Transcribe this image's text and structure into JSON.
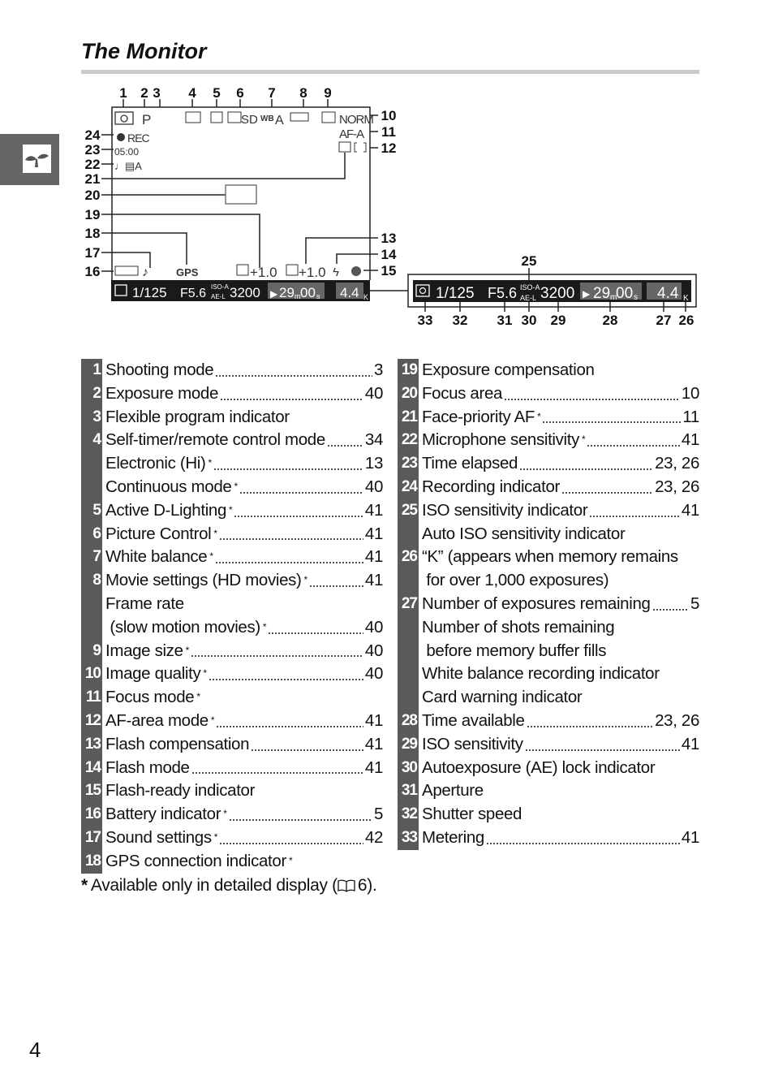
{
  "section_title": "The Monitor",
  "page_number": "4",
  "side_tab_icon": "seedling-icon",
  "diagram": {
    "callouts": [
      "1",
      "2",
      "3",
      "4",
      "5",
      "6",
      "7",
      "8",
      "9",
      "10",
      "11",
      "12",
      "13",
      "14",
      "15",
      "16",
      "17",
      "18",
      "19",
      "20",
      "21",
      "22",
      "23",
      "24",
      "25",
      "26",
      "27",
      "28",
      "29",
      "30",
      "31",
      "32",
      "33"
    ],
    "screen": {
      "rec": "REC",
      "time_elapsed": "05:00",
      "norm": "NORM",
      "focus_mode": "AF-A",
      "sd": "SD",
      "wb": "A",
      "gps": "GPS",
      "exp_comp": "+1.0",
      "flash_comp": "+1.0"
    },
    "bar": {
      "shutter": "1/125",
      "aperture": "F5.6",
      "iso_a": "ISO-A",
      "ae_l": "AE-L",
      "iso": "3200",
      "time_min": "29",
      "m": "m",
      "time_sec": "00",
      "s": "s",
      "exposures": "4.4",
      "k": "K"
    }
  },
  "left_items": [
    {
      "num": "1",
      "lines": [
        {
          "text": "Shooting mode",
          "page": "3"
        }
      ]
    },
    {
      "num": "2",
      "lines": [
        {
          "text": "Exposure mode",
          "page": "40"
        }
      ]
    },
    {
      "num": "3",
      "lines": [
        {
          "text": "Flexible program indicator"
        }
      ]
    },
    {
      "num": "4",
      "lines": [
        {
          "text": "Self-timer/remote control mode",
          "page": "34"
        },
        {
          "text": "Electronic (Hi)",
          "star": "*",
          "page": "13"
        },
        {
          "text": "Continuous mode",
          "star": "*",
          "page": "40"
        }
      ]
    },
    {
      "num": "5",
      "lines": [
        {
          "text": "Active D-Lighting",
          "star": "*",
          "page": "41"
        }
      ]
    },
    {
      "num": "6",
      "lines": [
        {
          "text": "Picture Control",
          "star": "*",
          "page": "41"
        }
      ]
    },
    {
      "num": "7",
      "lines": [
        {
          "text": "White balance",
          "star": "*",
          "page": "41"
        }
      ]
    },
    {
      "num": "8",
      "lines": [
        {
          "text": "Movie settings (HD movies)",
          "star": "*",
          "page": "41"
        },
        {
          "text": "Frame rate"
        },
        {
          "text": " (slow motion movies)",
          "star": "*",
          "page": "40"
        }
      ]
    },
    {
      "num": "9",
      "lines": [
        {
          "text": "Image size",
          "star": "*",
          "page": "40"
        }
      ]
    },
    {
      "num": "10",
      "lines": [
        {
          "text": "Image quality",
          "star": "*",
          "page": "40"
        }
      ]
    },
    {
      "num": "11",
      "lines": [
        {
          "text": "Focus mode",
          "star": "*"
        }
      ]
    },
    {
      "num": "12",
      "lines": [
        {
          "text": "AF-area mode",
          "star": "*",
          "page": "41"
        }
      ]
    },
    {
      "num": "13",
      "lines": [
        {
          "text": "Flash compensation",
          "page": "41"
        }
      ]
    },
    {
      "num": "14",
      "lines": [
        {
          "text": "Flash mode",
          "page": "41"
        }
      ]
    },
    {
      "num": "15",
      "lines": [
        {
          "text": "Flash-ready indicator"
        }
      ]
    },
    {
      "num": "16",
      "lines": [
        {
          "text": "Battery indicator",
          "star": "*",
          "page": "5"
        }
      ]
    },
    {
      "num": "17",
      "lines": [
        {
          "text": "Sound settings",
          "star": "*",
          "page": "42"
        }
      ]
    },
    {
      "num": "18",
      "lines": [
        {
          "text": "GPS connection indicator",
          "star": "*"
        }
      ]
    }
  ],
  "right_items": [
    {
      "num": "19",
      "lines": [
        {
          "text": "Exposure compensation"
        }
      ]
    },
    {
      "num": "20",
      "lines": [
        {
          "text": "Focus area",
          "page": "10"
        }
      ]
    },
    {
      "num": "21",
      "lines": [
        {
          "text": "Face-priority AF",
          "star": "*",
          "page": "11"
        }
      ]
    },
    {
      "num": "22",
      "lines": [
        {
          "text": "Microphone sensitivity",
          "star": "*",
          "page": "41"
        }
      ]
    },
    {
      "num": "23",
      "lines": [
        {
          "text": "Time elapsed",
          "page": "23, 26"
        }
      ]
    },
    {
      "num": "24",
      "lines": [
        {
          "text": "Recording indicator",
          "page": "23, 26"
        }
      ]
    },
    {
      "num": "25",
      "lines": [
        {
          "text": "ISO sensitivity indicator",
          "page": "41"
        },
        {
          "text": "Auto ISO sensitivity indicator"
        }
      ]
    },
    {
      "num": "26",
      "lines": [
        {
          "text": "“K” (appears when memory remains"
        },
        {
          "text": " for over 1,000 exposures)"
        }
      ]
    },
    {
      "num": "27",
      "lines": [
        {
          "text": "Number of exposures remaining",
          "page": "5"
        },
        {
          "text": "Number of shots remaining"
        },
        {
          "text": " before memory buffer fills"
        },
        {
          "text": "White balance recording indicator"
        },
        {
          "text": "Card warning indicator"
        }
      ]
    },
    {
      "num": "28",
      "lines": [
        {
          "text": "Time available",
          "page": "23, 26"
        }
      ]
    },
    {
      "num": "29",
      "lines": [
        {
          "text": "ISO sensitivity",
          "page": "41"
        }
      ]
    },
    {
      "num": "30",
      "lines": [
        {
          "text": "Autoexposure (AE) lock indicator"
        }
      ]
    },
    {
      "num": "31",
      "lines": [
        {
          "text": "Aperture"
        }
      ]
    },
    {
      "num": "32",
      "lines": [
        {
          "text": "Shutter speed"
        }
      ]
    },
    {
      "num": "33",
      "lines": [
        {
          "text": "Metering",
          "page": "41"
        }
      ]
    }
  ],
  "footnote": {
    "star": "*",
    "text": "Available only in detailed display (",
    "icon": "book-icon",
    "page": "6",
    "suffix": ")."
  }
}
